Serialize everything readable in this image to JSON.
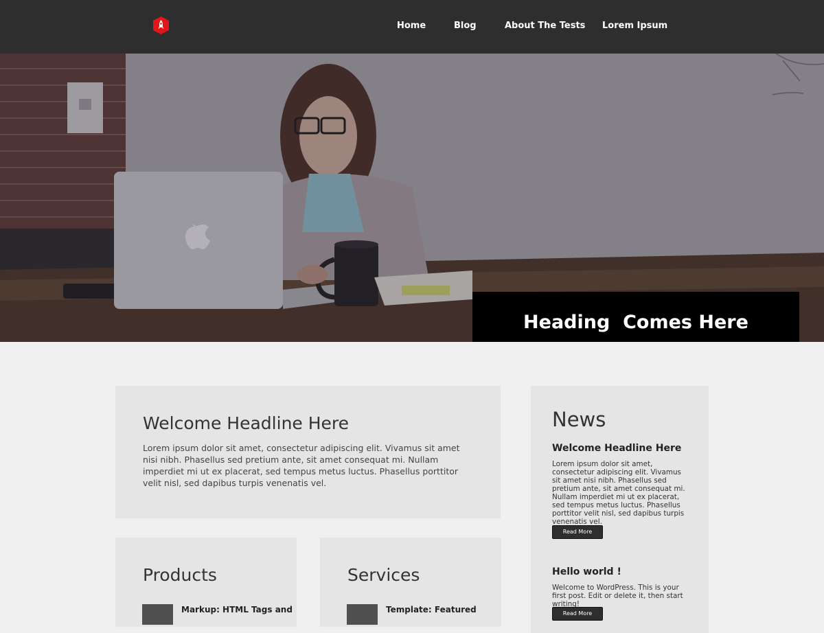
{
  "nav": {
    "items": [
      {
        "label": "Home"
      },
      {
        "label": "Blog"
      },
      {
        "label": "About The Tests"
      },
      {
        "label": "Lorem Ipsum"
      }
    ]
  },
  "colors": {
    "header_bg": "#2e2e2e",
    "logo_red": "#e0161a",
    "page_bg": "#f1f0f0",
    "panel_bg": "#e5e5e5",
    "hero_box_bg": "#000000"
  },
  "icons": {
    "logo": "rocket-badge-icon"
  },
  "hero": {
    "heading": "Heading  Comes Here"
  },
  "welcome": {
    "headline": "Welcome Headline Here",
    "body": "Lorem ipsum dolor sit amet, consectetur adipiscing elit. Vivamus sit amet nisi nibh. Phasellus sed pretium ante, sit amet consequat mi. Nullam imperdiet mi ut ex placerat, sed tempus metus luctus. Phasellus porttitor velit nisl, sed dapibus turpis venenatis vel."
  },
  "products": {
    "title": "Products",
    "first_item": "Markup: HTML Tags and"
  },
  "services": {
    "title": "Services",
    "first_item": "Template: Featured"
  },
  "news": {
    "title": "News",
    "posts": [
      {
        "title": "Welcome Headline Here",
        "body": "Lorem ipsum dolor sit amet, consectetur adipiscing elit. Vivamus sit amet nisi nibh. Phasellus sed pretium ante, sit amet consequat mi. Nullam imperdiet mi ut ex placerat, sed tempus metus luctus. Phasellus porttitor velit nisl, sed dapibus turpis venenatis vel.",
        "button": "Read More"
      },
      {
        "title": "Hello world !",
        "body": "Welcome to WordPress. This is your first post. Edit or delete it, then start writing!",
        "button": "Read More"
      }
    ]
  }
}
